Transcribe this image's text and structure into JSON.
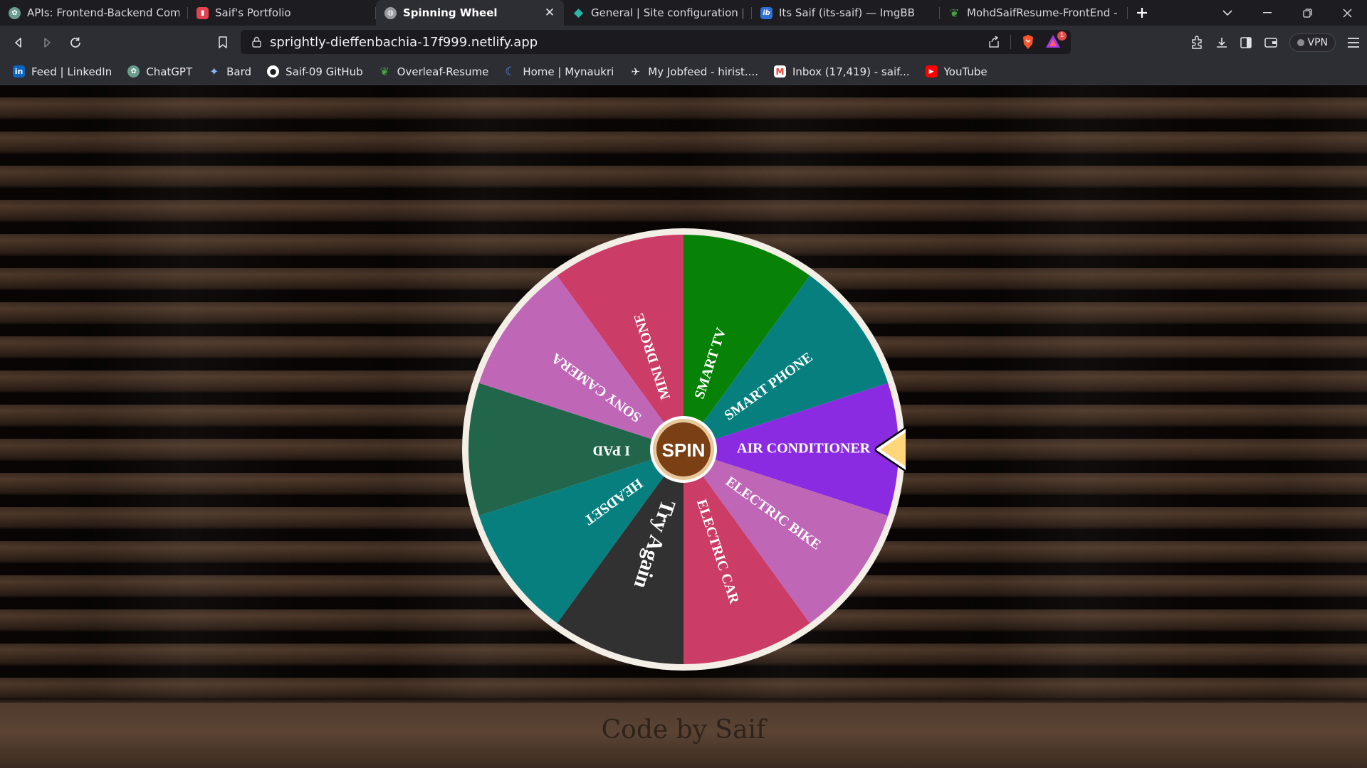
{
  "tabs": [
    {
      "title": "APIs: Frontend-Backend Commun",
      "favicon": "chatgpt-icon",
      "active": false
    },
    {
      "title": "Saif's Portfolio",
      "favicon": "portfolio-icon",
      "active": false
    },
    {
      "title": "Spinning Wheel",
      "favicon": "globe-icon",
      "active": true
    },
    {
      "title": "General | Site configuration | cyn",
      "favicon": "netlify-icon",
      "active": false
    },
    {
      "title": "Its Saif (its-saif) — ImgBB",
      "favicon": "imgbb-icon",
      "active": false
    },
    {
      "title": "MohdSaifResume-FrontEnd - On",
      "favicon": "overleaf-icon",
      "active": false
    }
  ],
  "address": {
    "url": "sprightly-dieffenbachia-17f999.netlify.app",
    "brave_badge": "1",
    "vpn_label": "VPN"
  },
  "bookmarks": [
    {
      "label": "Feed | LinkedIn",
      "icon": "linkedin-icon"
    },
    {
      "label": "ChatGPT",
      "icon": "chatgpt-icon"
    },
    {
      "label": "Bard",
      "icon": "bard-icon"
    },
    {
      "label": "Saif-09 GitHub",
      "icon": "github-icon"
    },
    {
      "label": "Overleaf-Resume",
      "icon": "overleaf-icon"
    },
    {
      "label": "Home | Mynaukri",
      "icon": "naukri-icon"
    },
    {
      "label": "My Jobfeed - hirist....",
      "icon": "hirist-icon"
    },
    {
      "label": "Inbox (17,419) - saif...",
      "icon": "gmail-icon"
    },
    {
      "label": "YouTube",
      "icon": "youtube-icon"
    }
  ],
  "wheel": {
    "spin_label": "SPIN",
    "segments": [
      {
        "label": "SMART TV",
        "color": "#078207"
      },
      {
        "label": "SMART PHONE",
        "color": "#087f7f"
      },
      {
        "label": "AIR CONDITIONER",
        "color": "#8a2be2"
      },
      {
        "label": "ELECTRIC BIKE",
        "color": "#c066b7"
      },
      {
        "label": "ELECTRIC CAR",
        "color": "#cb3c66"
      },
      {
        "label": "Try Again",
        "color": "#313131"
      },
      {
        "label": "HEADSET",
        "color": "#087f7f"
      },
      {
        "label": "I PAD",
        "color": "#21664a"
      },
      {
        "label": "SONY CAMERA",
        "color": "#c066b7"
      },
      {
        "label": "MINI DRONE",
        "color": "#cb3c66"
      }
    ],
    "pointer_color": "#ffd77a",
    "hub_color": "#7b3f14",
    "rim_color": "#f4efe6"
  },
  "footer": {
    "credit": "Code by Saif"
  }
}
